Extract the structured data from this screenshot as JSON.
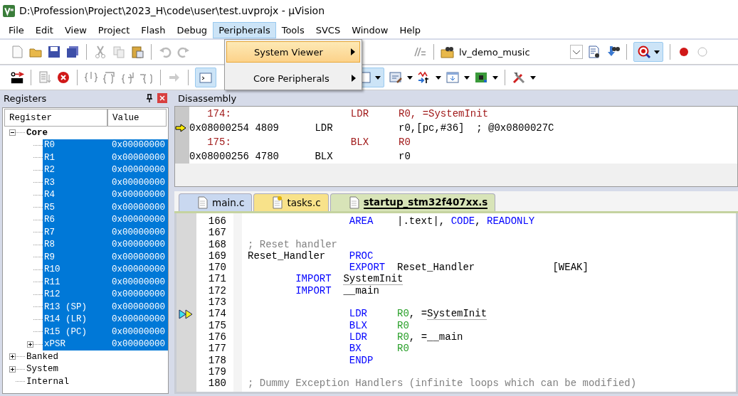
{
  "window": {
    "title": "D:\\Profession\\Project\\2023_H\\code\\user\\test.uvprojx - µVision"
  },
  "menu": [
    {
      "label": "File",
      "selected": false
    },
    {
      "label": "Edit",
      "selected": false
    },
    {
      "label": "View",
      "selected": false
    },
    {
      "label": "Project",
      "selected": false
    },
    {
      "label": "Flash",
      "selected": false
    },
    {
      "label": "Debug",
      "selected": false
    },
    {
      "label": "Peripherals",
      "selected": true
    },
    {
      "label": "Tools",
      "selected": false
    },
    {
      "label": "SVCS",
      "selected": false
    },
    {
      "label": "Window",
      "selected": false
    },
    {
      "label": "Help",
      "selected": false
    }
  ],
  "dropdown": [
    {
      "label": "System Viewer",
      "selected": true
    },
    {
      "label": "Core Peripherals",
      "selected": false
    }
  ],
  "toolbar": {
    "target": "lv_demo_music"
  },
  "registers": {
    "title": "Registers",
    "columns": [
      "Register",
      "Value"
    ],
    "tree": [
      {
        "name": "Core",
        "expanded": true,
        "selected": false,
        "children": [
          {
            "name": "R0",
            "value": "0x00000000",
            "selected": true
          },
          {
            "name": "R1",
            "value": "0x00000000",
            "selected": true
          },
          {
            "name": "R2",
            "value": "0x00000000",
            "selected": true
          },
          {
            "name": "R3",
            "value": "0x00000000",
            "selected": true
          },
          {
            "name": "R4",
            "value": "0x00000000",
            "selected": true
          },
          {
            "name": "R5",
            "value": "0x00000000",
            "selected": true
          },
          {
            "name": "R6",
            "value": "0x00000000",
            "selected": true
          },
          {
            "name": "R7",
            "value": "0x00000000",
            "selected": true
          },
          {
            "name": "R8",
            "value": "0x00000000",
            "selected": true
          },
          {
            "name": "R9",
            "value": "0x00000000",
            "selected": true
          },
          {
            "name": "R10",
            "value": "0x00000000",
            "selected": true
          },
          {
            "name": "R11",
            "value": "0x00000000",
            "selected": true
          },
          {
            "name": "R12",
            "value": "0x00000000",
            "selected": true
          },
          {
            "name": "R13 (SP)",
            "value": "0x00000000",
            "selected": true
          },
          {
            "name": "R14 (LR)",
            "value": "0x00000000",
            "selected": true
          },
          {
            "name": "R15 (PC)",
            "value": "0x00000000",
            "selected": true
          },
          {
            "name": "xPSR",
            "value": "0x00000000",
            "selected": true,
            "expanded": false
          }
        ]
      },
      {
        "name": "Banked",
        "expanded": false,
        "selected": false
      },
      {
        "name": "System",
        "expanded": false,
        "selected": false
      },
      {
        "name": "Internal",
        "selected": false
      }
    ]
  },
  "disassembly": {
    "title": "Disassembly",
    "lines": [
      {
        "kind": "source",
        "text": "174:                    LDR     R0, =SystemInit",
        "current": false
      },
      {
        "kind": "asm",
        "text": "0x08000254 4809      LDR           r0,[pc,#36]  ; @0x0800027C",
        "current": true
      },
      {
        "kind": "source",
        "text": "175:                    BLX     R0",
        "current": false
      },
      {
        "kind": "asm",
        "text": "0x08000256 4780      BLX           r0",
        "current": false
      }
    ]
  },
  "tabs": [
    {
      "label": "main.c",
      "selected": false,
      "kind": "plain"
    },
    {
      "label": "tasks.c",
      "selected": false,
      "kind": "key"
    },
    {
      "label": "startup_stm32f407xx.s",
      "selected": true,
      "kind": "plain"
    }
  ],
  "editor": {
    "lines": [
      {
        "number": "166",
        "marker": false,
        "kind": "deep",
        "op": "AREA",
        "operands": [
          {
            "kind": "plain",
            "text": "|.text|, "
          },
          {
            "kind": "keyword",
            "text": "CODE"
          },
          {
            "kind": "plain",
            "text": ", "
          },
          {
            "kind": "keyword",
            "text": "READONLY"
          }
        ]
      },
      {
        "number": "167",
        "marker": false
      },
      {
        "number": "168",
        "marker": false,
        "comment": "; Reset handler"
      },
      {
        "number": "169",
        "marker": false,
        "kind": "deep",
        "label": "Reset_Handler",
        "op": "PROC"
      },
      {
        "number": "170",
        "marker": false,
        "kind": "deep",
        "op": "EXPORT",
        "operands": [
          {
            "kind": "plain",
            "text": "Reset_Handler             [WEAK]"
          }
        ]
      },
      {
        "number": "171",
        "marker": false,
        "kind": "shallow",
        "op": "IMPORT",
        "operands": [
          {
            "kind": "link",
            "text": "SystemInit"
          }
        ]
      },
      {
        "number": "172",
        "marker": false,
        "kind": "shallow",
        "op": "IMPORT",
        "operands": [
          {
            "kind": "plain",
            "text": "__main"
          }
        ]
      },
      {
        "number": "173",
        "marker": false
      },
      {
        "number": "174",
        "marker": true,
        "kind": "deep",
        "op": "LDR",
        "operands": [
          {
            "kind": "register",
            "text": "R0"
          },
          {
            "kind": "plain",
            "text": ", ="
          },
          {
            "kind": "link",
            "text": "SystemInit"
          }
        ]
      },
      {
        "number": "175",
        "marker": false,
        "kind": "deep",
        "op": "BLX",
        "operands": [
          {
            "kind": "register",
            "text": "R0"
          }
        ]
      },
      {
        "number": "176",
        "marker": false,
        "kind": "deep",
        "op": "LDR",
        "operands": [
          {
            "kind": "register",
            "text": "R0"
          },
          {
            "kind": "plain",
            "text": ", =__main"
          }
        ]
      },
      {
        "number": "177",
        "marker": false,
        "kind": "deep",
        "op": "BX",
        "operands": [
          {
            "kind": "register",
            "text": "R0"
          }
        ]
      },
      {
        "number": "178",
        "marker": false,
        "kind": "deep",
        "op": "ENDP"
      },
      {
        "number": "179",
        "marker": false
      },
      {
        "number": "180",
        "marker": false,
        "comment": "; Dummy Exception Handlers (infinite loops which can be modified)"
      }
    ]
  }
}
